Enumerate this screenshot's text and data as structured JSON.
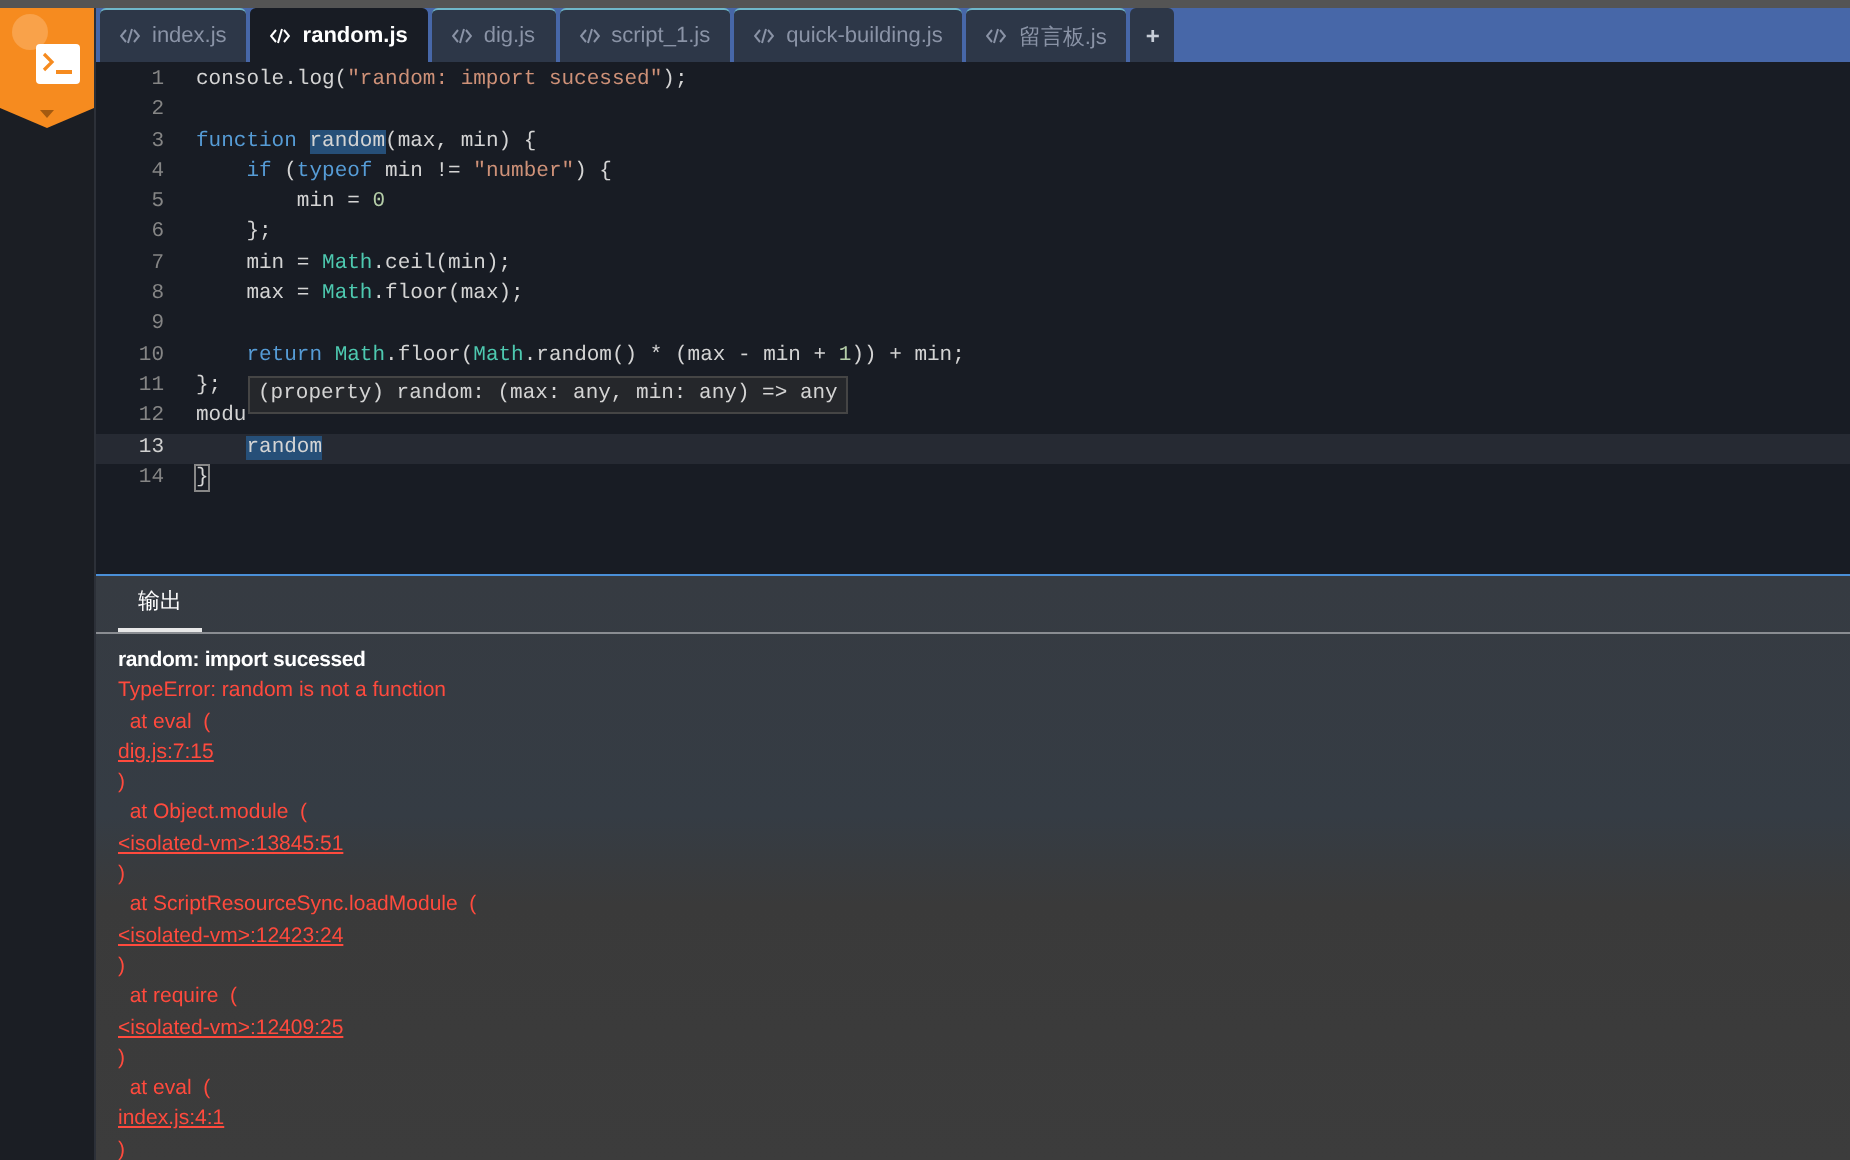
{
  "tabs": [
    {
      "label": "index.js",
      "selected": false
    },
    {
      "label": "random.js",
      "selected": true
    },
    {
      "label": "dig.js",
      "selected": false
    },
    {
      "label": "script_1.js",
      "selected": false
    },
    {
      "label": "quick-building.js",
      "selected": false
    },
    {
      "label": "留言板.js",
      "selected": false
    }
  ],
  "new_tab_button": "+",
  "editor": {
    "lines": [
      {
        "number": "1",
        "current": false,
        "tokens": [
          {
            "kind": "plain",
            "text": "console.log("
          },
          {
            "kind": "string",
            "text": "\"random: import sucessed\""
          },
          {
            "kind": "plain",
            "text": ");"
          }
        ]
      },
      {
        "number": "2",
        "current": false
      },
      {
        "number": "3",
        "current": false,
        "tokens": [
          {
            "kind": "keyword",
            "text": "function "
          },
          {
            "kind": "highlight",
            "text": "random"
          },
          {
            "kind": "plain",
            "text": "(max, min) {"
          }
        ]
      },
      {
        "number": "4",
        "current": false,
        "tokens": [
          {
            "kind": "keyword",
            "text": "    if"
          },
          {
            "kind": "plain",
            "text": " ("
          },
          {
            "kind": "keyword",
            "text": "typeof"
          },
          {
            "kind": "plain",
            "text": " min != "
          },
          {
            "kind": "string",
            "text": "\"number\""
          },
          {
            "kind": "plain",
            "text": ") {"
          }
        ]
      },
      {
        "number": "5",
        "current": false,
        "tokens": [
          {
            "kind": "plain",
            "text": "        min = "
          },
          {
            "kind": "number",
            "text": "0"
          }
        ]
      },
      {
        "number": "6",
        "current": false,
        "tokens": [
          {
            "kind": "plain",
            "text": "    };"
          }
        ]
      },
      {
        "number": "7",
        "current": false,
        "tokens": [
          {
            "kind": "plain",
            "text": "    min = "
          },
          {
            "kind": "type",
            "text": "Math"
          },
          {
            "kind": "plain",
            "text": ".ceil(min);"
          }
        ]
      },
      {
        "number": "8",
        "current": false,
        "tokens": [
          {
            "kind": "plain",
            "text": "    max = "
          },
          {
            "kind": "type",
            "text": "Math"
          },
          {
            "kind": "plain",
            "text": ".floor(max);"
          }
        ]
      },
      {
        "number": "9",
        "current": false
      },
      {
        "number": "10",
        "current": false,
        "tokens": [
          {
            "kind": "keyword",
            "text": "    return "
          },
          {
            "kind": "type",
            "text": "Math"
          },
          {
            "kind": "plain",
            "text": ".floor("
          },
          {
            "kind": "type",
            "text": "Math"
          },
          {
            "kind": "plain",
            "text": ".random() * (max - min + "
          },
          {
            "kind": "number",
            "text": "1"
          },
          {
            "kind": "plain",
            "text": ")) + min;"
          }
        ]
      },
      {
        "number": "11",
        "current": false,
        "tokens": [
          {
            "kind": "plain",
            "text": "};"
          }
        ]
      },
      {
        "number": "12",
        "current": false,
        "tokens": [
          {
            "kind": "plain",
            "text": "modu"
          }
        ]
      },
      {
        "number": "13",
        "current": true,
        "tokens": [
          {
            "kind": "highlight",
            "text": "    random"
          }
        ]
      },
      {
        "number": "14",
        "current": false,
        "tokens": [
          {
            "kind": "bracket",
            "text": "}"
          }
        ]
      }
    ],
    "tooltip": "(property) random: (max: any, min: any) => any"
  },
  "output": {
    "tabs": [
      {
        "label": "输出",
        "selected": true
      }
    ],
    "lines": [
      {
        "kind": "info",
        "text": "random: import sucessed"
      },
      {
        "kind": "error",
        "text": "TypeError: random is not a function"
      },
      {
        "kind": "error",
        "text": "  at eval  ("
      },
      {
        "kind": "link",
        "text": "dig.js:7:15"
      },
      {
        "kind": "error",
        "text": ")"
      },
      {
        "kind": "error",
        "text": "  at Object.module  ("
      },
      {
        "kind": "link",
        "text": "<isolated-vm>:13845:51"
      },
      {
        "kind": "error",
        "text": ")"
      },
      {
        "kind": "error",
        "text": "  at ScriptResourceSync.loadModule  ("
      },
      {
        "kind": "link",
        "text": "<isolated-vm>:12423:24"
      },
      {
        "kind": "error",
        "text": ")"
      },
      {
        "kind": "error",
        "text": "  at require  ("
      },
      {
        "kind": "link",
        "text": "<isolated-vm>:12409:25"
      },
      {
        "kind": "error",
        "text": ")"
      },
      {
        "kind": "error",
        "text": "  at eval  ("
      },
      {
        "kind": "link",
        "text": "index.js:4:1"
      },
      {
        "kind": "error",
        "text": ")"
      }
    ]
  }
}
